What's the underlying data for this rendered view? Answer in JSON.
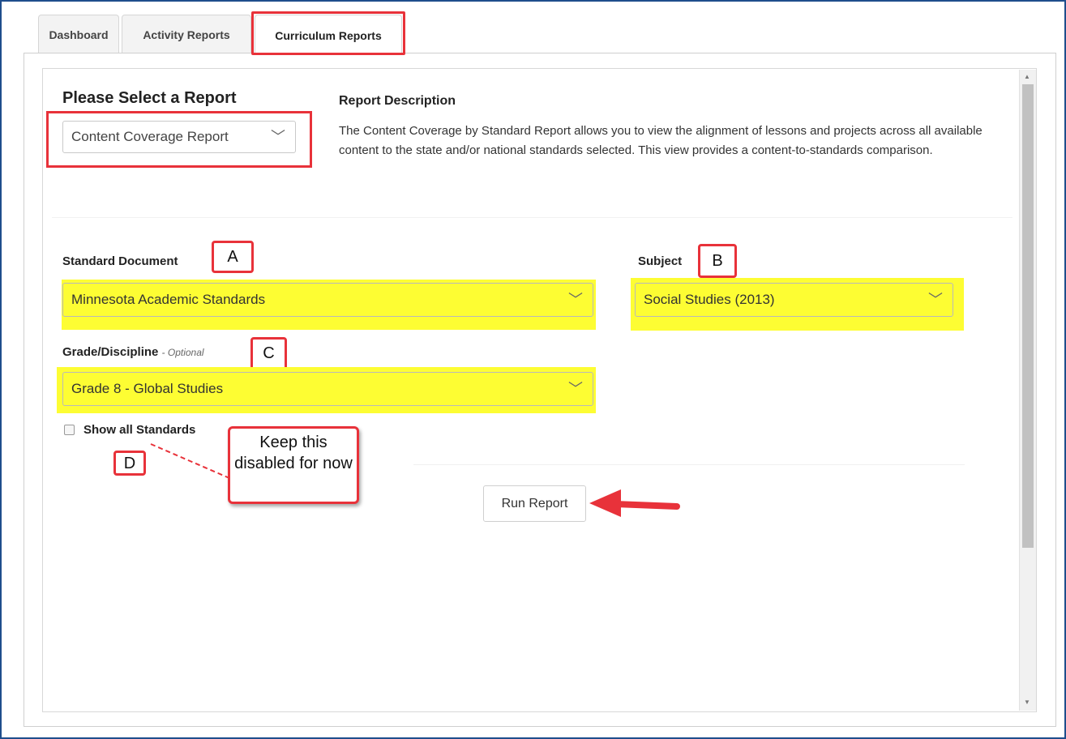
{
  "tabs": [
    {
      "label": "Dashboard"
    },
    {
      "label": "Activity Reports"
    },
    {
      "label": "Curriculum Reports"
    }
  ],
  "report": {
    "heading": "Please Select a Report",
    "selected": "Content Coverage Report",
    "description_title": "Report Description",
    "description": "The Content Coverage by Standard Report allows you to view the alignment of lessons and projects across all available content to the state and/or national standards selected. This view provides a content-to-standards comparison."
  },
  "form": {
    "standard_document_label": "Standard Document",
    "standard_document_value": "Minnesota Academic Standards",
    "subject_label": "Subject",
    "subject_value": "Social Studies (2013)",
    "grade_label": "Grade/Discipline",
    "grade_optional": "- Optional",
    "grade_value": "Grade 8 - Global Studies",
    "show_all_label": "Show all Standards",
    "run_button": "Run Report"
  },
  "annotations": {
    "a": "A",
    "b": "B",
    "c": "C",
    "d": "D",
    "note": "Keep this disabled for now",
    "highlight_color": "#fdfd33",
    "callout_color": "#e8323a"
  },
  "icons": {
    "dropdown": "chevron-down-icon",
    "scroll_up": "triangle-up-icon",
    "scroll_down": "triangle-down-icon"
  }
}
